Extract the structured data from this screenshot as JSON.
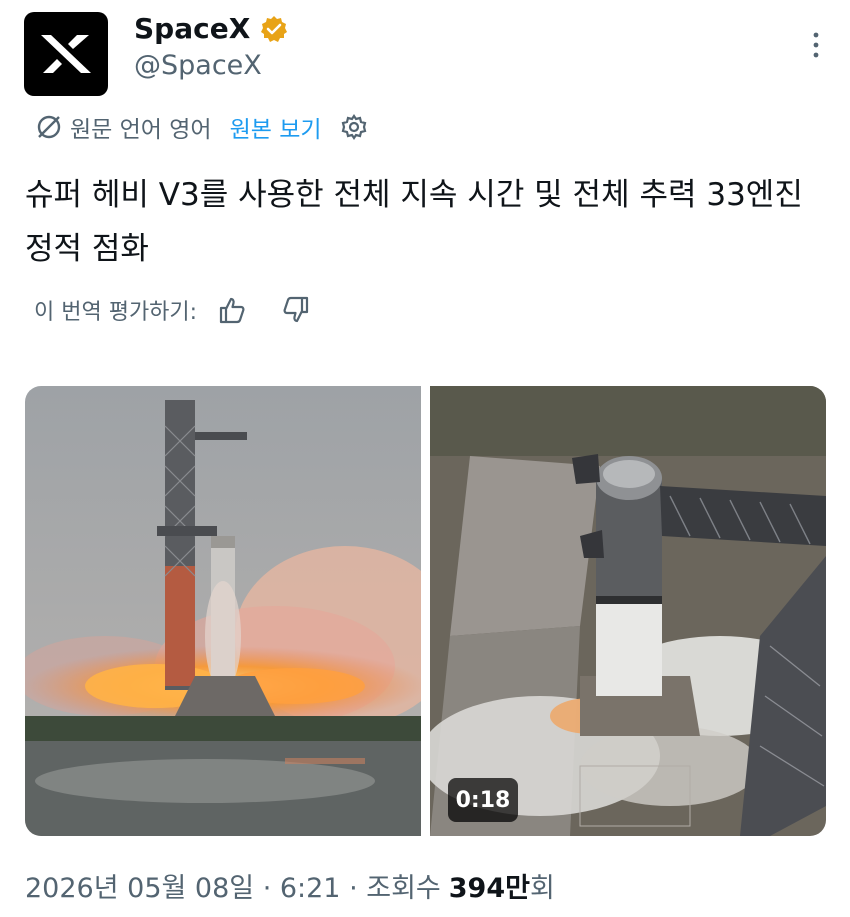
{
  "author": {
    "display_name": "SpaceX",
    "handle": "@SpaceX",
    "verified": true,
    "badge_color": "#e8a317",
    "avatar_icon": "spacex-x-logo"
  },
  "translation": {
    "source_label": "원문 언어 영어",
    "show_original_label": "원본 보기",
    "link_color": "#1d9bf0"
  },
  "post": {
    "text": "슈퍼 헤비 V3를 사용한 전체 지속 시간 및 전체 추력 33엔진 정적 점화"
  },
  "rating": {
    "label": "이 번역 평가하기:"
  },
  "media": {
    "video_duration": "0:18"
  },
  "meta": {
    "date_time": "2026년 05월 08일 · 6:21 · 조회수",
    "views_number": "394만",
    "views_suffix": "회"
  }
}
